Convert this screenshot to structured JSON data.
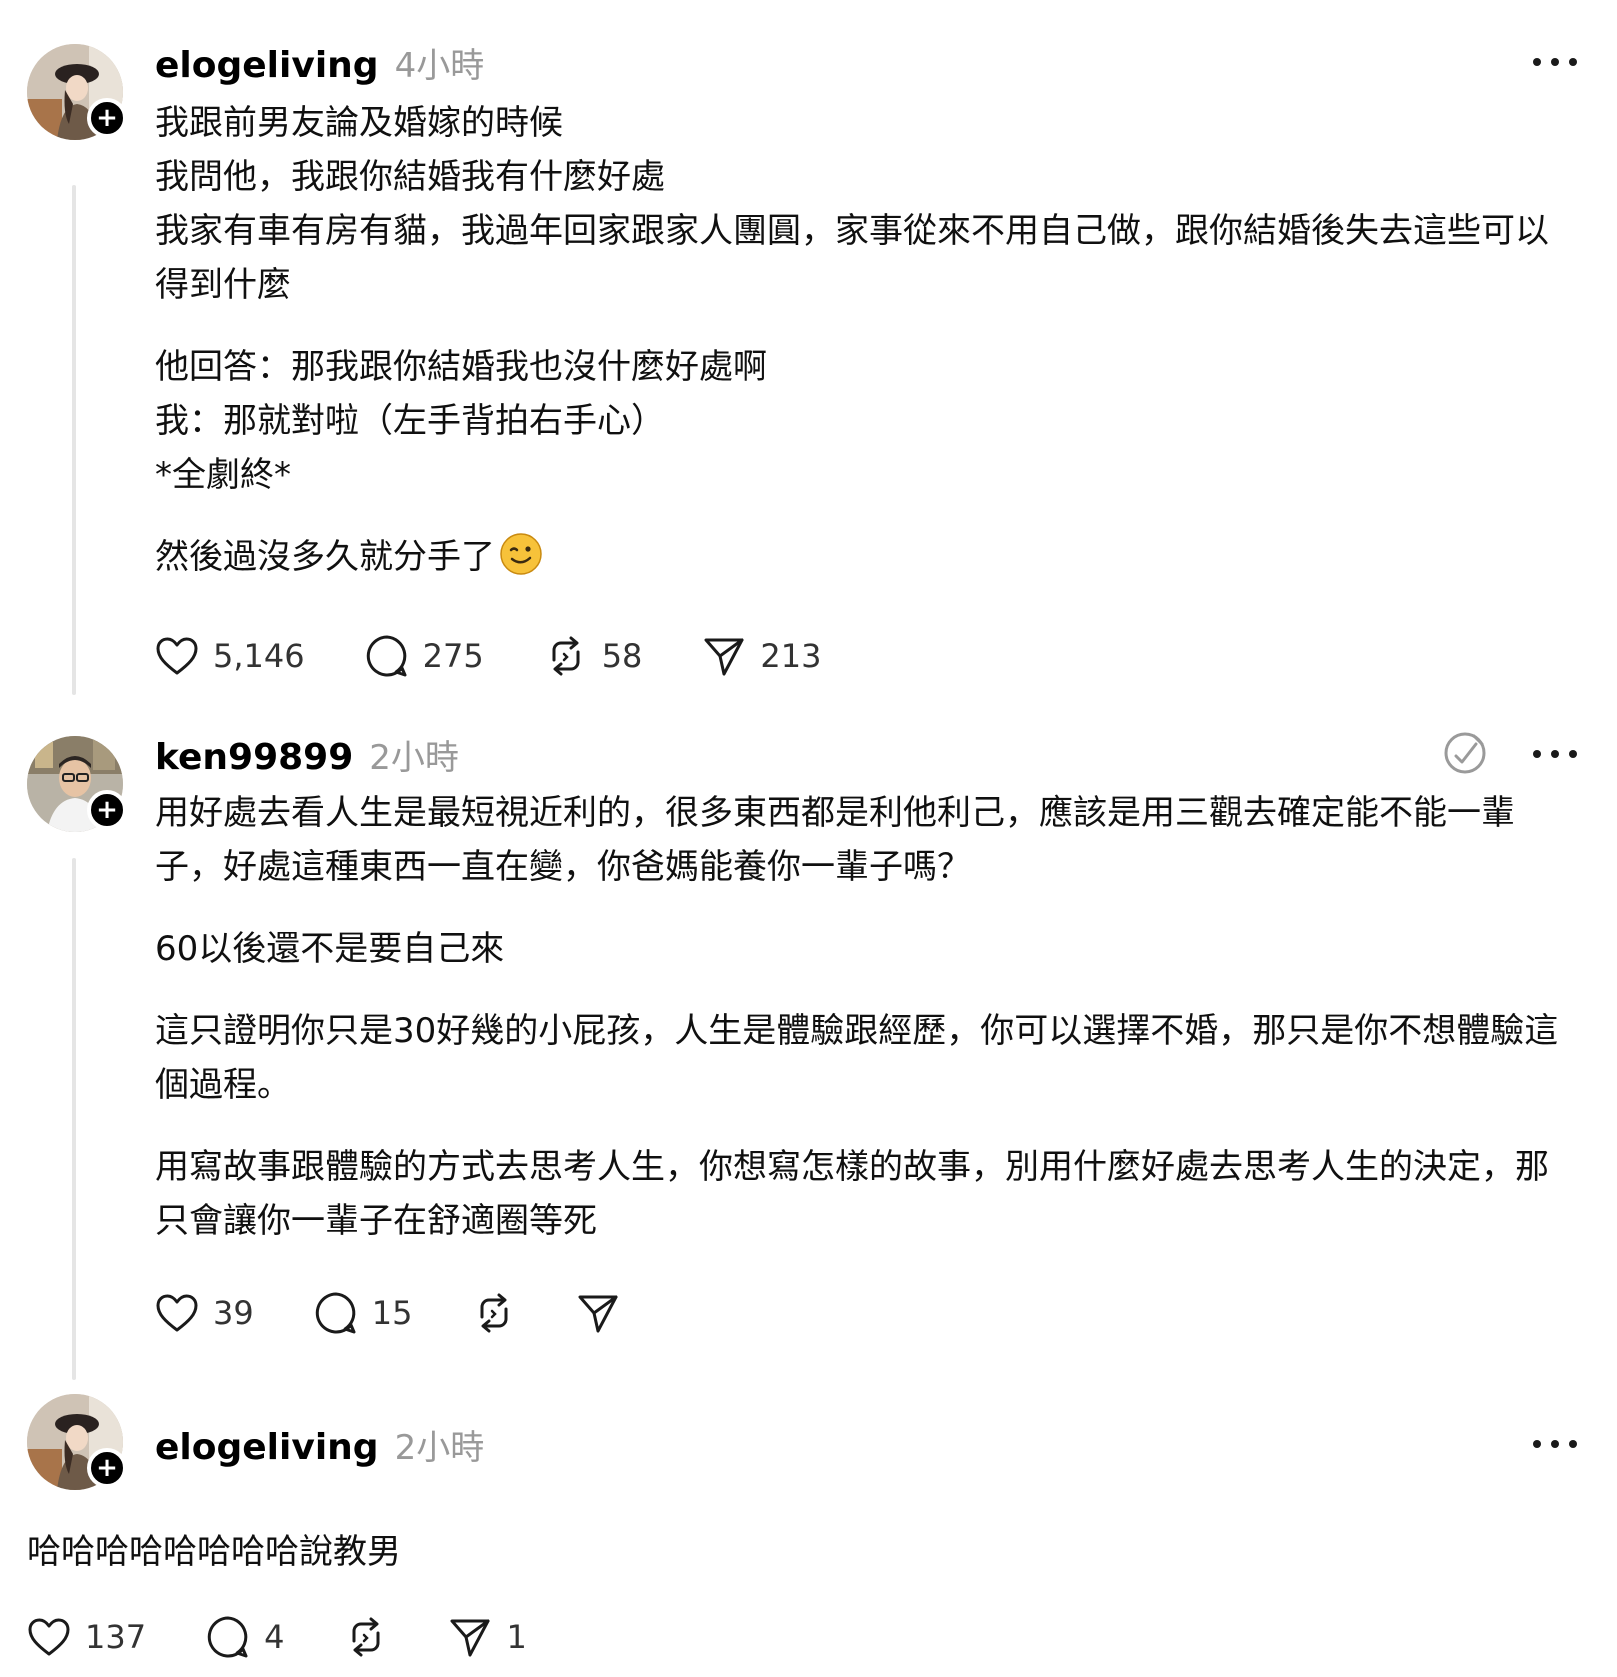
{
  "posts": [
    {
      "username": "elogeliving",
      "time": "4小時",
      "paragraphs": [
        "我跟前男友論及婚嫁的時候\n我問他，我跟你結婚我有什麼好處\n我家有車有房有貓，我過年回家跟家人團圓，家事從來不用自己做，跟你結婚後失去這些可以得到什麼",
        "他回答：那我跟你結婚我也沒什麼好處啊\n我：那就對啦（左手背拍右手心）\n*全劇終*",
        "然後過沒多久就分手了"
      ],
      "likes": "5,146",
      "comments": "275",
      "reposts": "58",
      "shares": "213"
    },
    {
      "username": "ken99899",
      "time": "2小時",
      "paragraphs": [
        "用好處去看人生是最短視近利的，很多東西都是利他利己，應該是用三觀去確定能不能一輩子，好處這種東西一直在變，你爸媽能養你一輩子嗎？",
        "60以後還不是要自己來",
        "這只證明你只是30好幾的小屁孩，人生是體驗跟經歷，你可以選擇不婚，那只是你不想體驗這個過程。",
        "用寫故事跟體驗的方式去思考人生，你想寫怎樣的故事，別用什麼好處去思考人生的決定，那只會讓你一輩子在舒適圈等死"
      ],
      "likes": "39",
      "comments": "15"
    },
    {
      "username": "elogeliving",
      "time": "2小時",
      "paragraphs": [
        "哈哈哈哈哈哈哈哈說教男"
      ],
      "likes": "137",
      "comments": "4",
      "shares": "1"
    }
  ],
  "icons": {
    "follow": "plus-icon",
    "more": "more-dots-icon",
    "translate": "translate-icon",
    "like": "heart-icon",
    "comment": "comment-bubble-icon",
    "repost": "repost-icon",
    "share": "send-icon",
    "emoji": "winking-face-emoji"
  },
  "colors": {
    "text": "#101010",
    "muted": "#999999",
    "thread_line": "#e5e5e5",
    "badge": "#000000"
  }
}
